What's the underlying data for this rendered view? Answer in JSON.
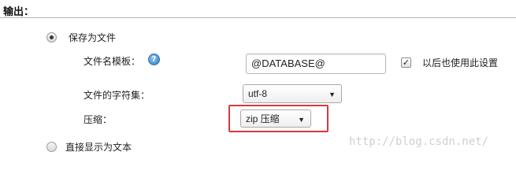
{
  "section": {
    "title": "输出："
  },
  "output_options": {
    "save_as_file": {
      "label": "保存为文件",
      "selected": true
    },
    "show_as_text": {
      "label": "直接显示为文本",
      "selected": false
    }
  },
  "filename_template": {
    "label": "文件名模板：",
    "help_icon": "help-icon",
    "value": "@DATABASE@",
    "remember_label": "以后也使用此设置",
    "remember_checked": true
  },
  "charset": {
    "label": "文件的字符集：",
    "value": "utf-8"
  },
  "compression": {
    "label": "压缩：",
    "value": "zip 压缩"
  },
  "watermark": {
    "text": "http://blog.csdn.net/"
  }
}
